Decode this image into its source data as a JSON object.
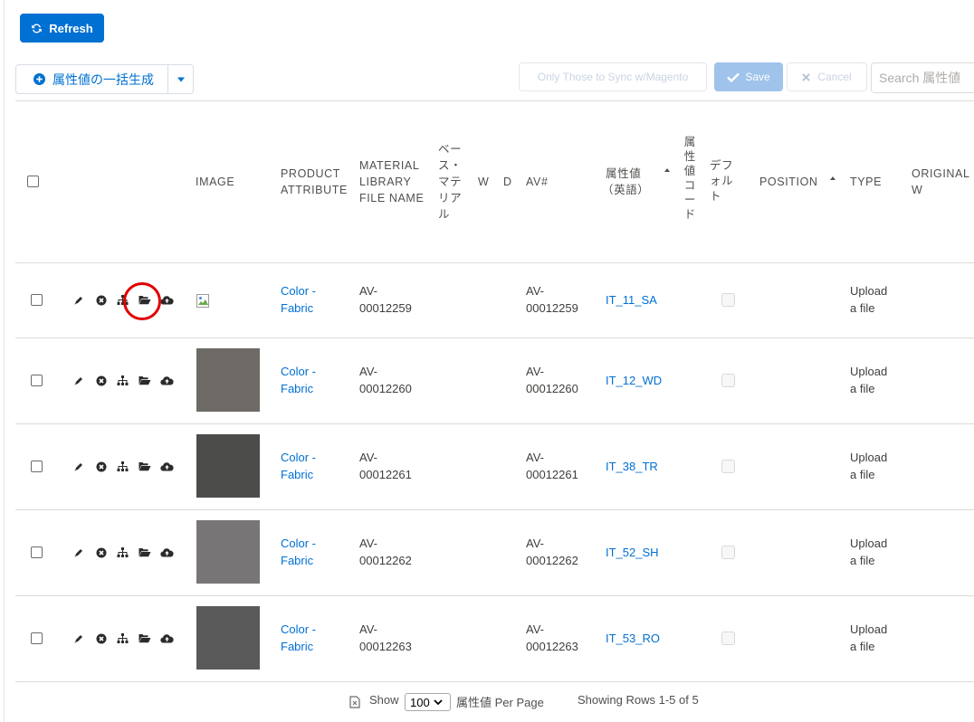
{
  "toolbar": {
    "refresh_label": "Refresh",
    "bulk_generate_label": "属性値の一括生成",
    "sync_filter_label": "Only Those to Sync w/Magento",
    "save_label": "Save",
    "cancel_label": "Cancel",
    "search_placeholder": "Search 属性値"
  },
  "columns": {
    "image": "IMAGE",
    "product_attribute_1": "PRODUCT",
    "product_attribute_2": "ATTRIBUTE",
    "material_1": "MATERIAL",
    "material_2": "LIBRARY",
    "material_3": "FILE NAME",
    "base_material": [
      "ベ",
      "ー",
      "ス",
      "・",
      "マ",
      "テ",
      "リ",
      "ア",
      "ル"
    ],
    "w": "W",
    "d": "D",
    "av_no": "AV#",
    "attr_value_1": "属性値",
    "attr_value_2": "（英語）",
    "attr_code": [
      "属",
      "性",
      "値",
      "コ",
      "ー",
      "ド"
    ],
    "default": [
      "デ",
      "フ",
      "ォ",
      "ル",
      "ト"
    ],
    "position": "POSITION",
    "type": "TYPE",
    "original_1": "ORIGINAL",
    "original_2": "W"
  },
  "rows": [
    {
      "product_attribute_1": "Color -",
      "product_attribute_2": "Fabric",
      "material_1": "AV-",
      "material_2": "00012259",
      "av_1": "AV-",
      "av_2": "00012259",
      "attr_value": "IT_11_SA",
      "type_1": "Upload",
      "type_2": "a file",
      "image": "broken",
      "color": ""
    },
    {
      "product_attribute_1": "Color -",
      "product_attribute_2": "Fabric",
      "material_1": "AV-",
      "material_2": "00012260",
      "av_1": "AV-",
      "av_2": "00012260",
      "attr_value": "IT_12_WD",
      "type_1": "Upload",
      "type_2": "a file",
      "image": "swatch",
      "color": "#6e6a66"
    },
    {
      "product_attribute_1": "Color -",
      "product_attribute_2": "Fabric",
      "material_1": "AV-",
      "material_2": "00012261",
      "av_1": "AV-",
      "av_2": "00012261",
      "attr_value": "IT_38_TR",
      "type_1": "Upload",
      "type_2": "a file",
      "image": "swatch",
      "color": "#4c4d4a"
    },
    {
      "product_attribute_1": "Color -",
      "product_attribute_2": "Fabric",
      "material_1": "AV-",
      "material_2": "00012262",
      "av_1": "AV-",
      "av_2": "00012262",
      "attr_value": "IT_52_SH",
      "type_1": "Upload",
      "type_2": "a file",
      "image": "swatch",
      "color": "#777576"
    },
    {
      "product_attribute_1": "Color -",
      "product_attribute_2": "Fabric",
      "material_1": "AV-",
      "material_2": "00012263",
      "av_1": "AV-",
      "av_2": "00012263",
      "attr_value": "IT_53_RO",
      "type_1": "Upload",
      "type_2": "a file",
      "image": "swatch",
      "color": "#5a5a5a"
    }
  ],
  "footer": {
    "show_label": "Show",
    "page_size": "100",
    "per_page_label": "属性値 Per Page",
    "rows_info": "Showing Rows 1-5 of 5"
  },
  "colors": {
    "brand": "#0070d2",
    "save_disabled": "#9fc3ea",
    "highlight": "#e10000"
  }
}
